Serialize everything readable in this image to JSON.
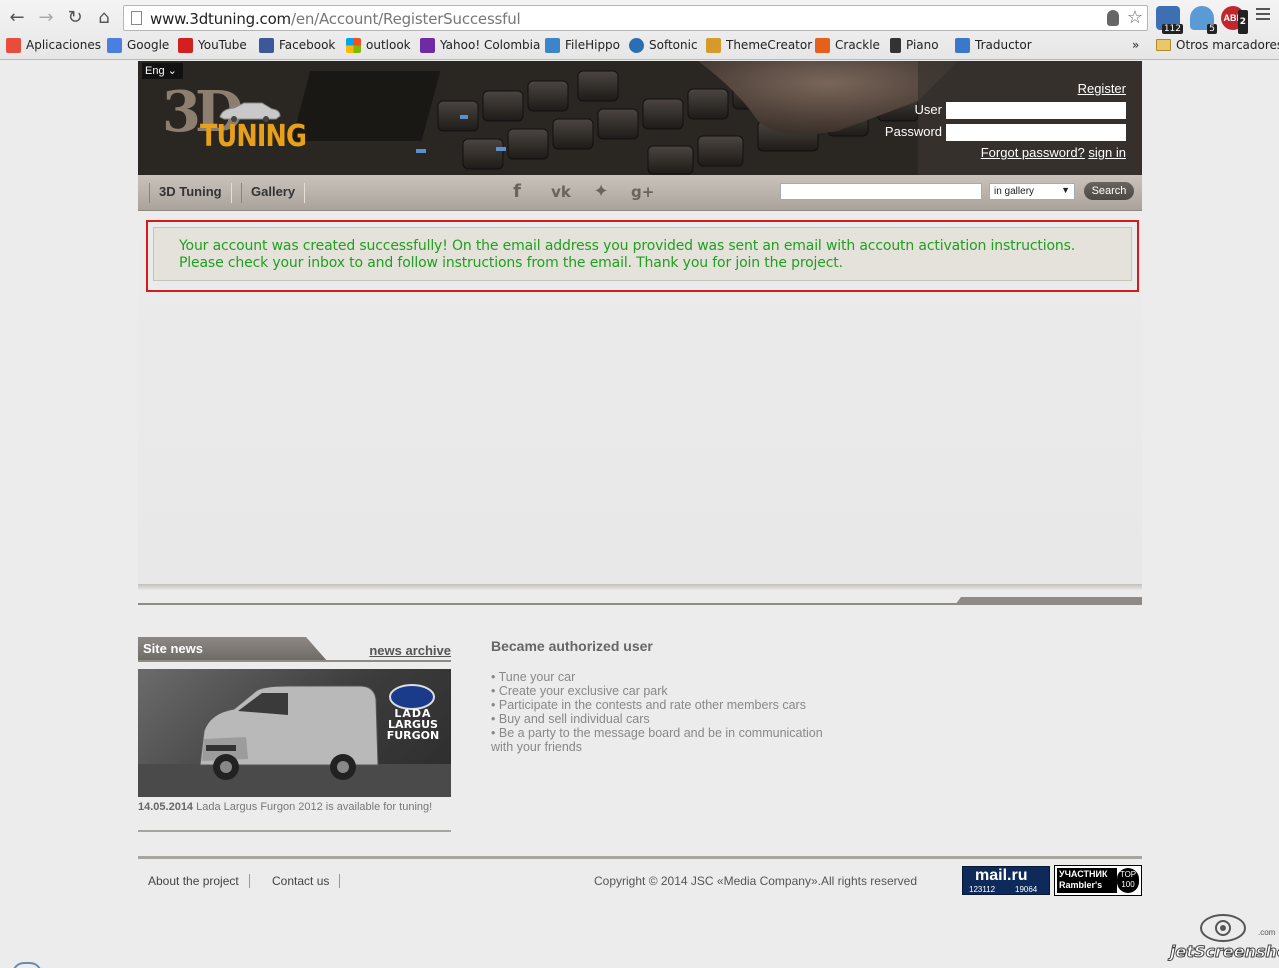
{
  "browser": {
    "url_host": "www.3dtuning.com",
    "url_path": "/en/Account/RegisterSuccessful",
    "extensions": [
      {
        "name": "weather-extension",
        "badge": "112",
        "color": "#3c6fb4"
      },
      {
        "name": "ghostery-extension",
        "badge": "5",
        "color": "#5a9bd6"
      },
      {
        "name": "adblock-plus-extension",
        "badge": "2",
        "color": "#c1272d",
        "label": "ABP"
      }
    ],
    "bookmarks": [
      {
        "label": "Aplicaciones",
        "icon": "apps-grid-icon",
        "color": "#e84c3d"
      },
      {
        "label": "Google",
        "icon": "google-icon",
        "color": "#4a7fe0"
      },
      {
        "label": "YouTube",
        "icon": "youtube-icon",
        "color": "#d21f1f"
      },
      {
        "label": "Facebook",
        "icon": "facebook-icon",
        "color": "#3b5998"
      },
      {
        "label": "outlook",
        "icon": "outlook-icon",
        "color": "#f0a30a"
      },
      {
        "label": "Yahoo! Colombia",
        "icon": "yahoo-icon",
        "color": "#6f2ba3"
      },
      {
        "label": "FileHippo",
        "icon": "filehippo-icon",
        "color": "#3a86c8"
      },
      {
        "label": "Softonic",
        "icon": "softonic-icon",
        "color": "#2a6fb3"
      },
      {
        "label": "ThemeCreator",
        "icon": "themecreator-icon",
        "color": "#d49a2a"
      },
      {
        "label": "Crackle",
        "icon": "crackle-icon",
        "color": "#e4601c"
      },
      {
        "label": "Piano",
        "icon": "piano-icon",
        "color": "#333333"
      },
      {
        "label": "Traductor",
        "icon": "translate-icon",
        "color": "#3b78c9"
      }
    ],
    "bookmarks_overflow": "»",
    "other_bookmarks": "Otros marcadores"
  },
  "site": {
    "lang": "Eng",
    "logo_3d": "3D",
    "logo_text": "TUNING",
    "register": "Register",
    "user_label": "User",
    "password_label": "Password",
    "forgot": "Forgot password?",
    "signin": "sign in",
    "nav": [
      "3D Tuning",
      "Gallery"
    ],
    "search_scope": "in gallery",
    "search_button": "Search",
    "message_line1": "Your account was created successfully! On the email address you provided was sent an email with accoutn activation instructions.",
    "message_line2": "Please check your inbox to and follow instructions from the email. Thank you for join the project.",
    "message_color": "#1fa01f",
    "highlight_color": "#d61b1b"
  },
  "news": {
    "header": "Site news",
    "archive": "news archive",
    "brand_line1": "LADA",
    "brand_line2": "LARGUS",
    "brand_line3": "FURGON",
    "date": "14.05.2014",
    "text": "Lada Largus Furgon 2012 is available for tuning!"
  },
  "authorized": {
    "title": "Became authorized user",
    "items": [
      "Tune your car",
      "Create your exclusive car park",
      "Participate in the contests and rate other members cars",
      "Buy and sell individual cars",
      "Be a party to the message board and be in communication with your friends"
    ]
  },
  "footer": {
    "links": [
      "About the project",
      "Contact us"
    ],
    "copyright": "Copyright © 2014 JSC «Media Company».All rights reserved",
    "mailru_logo": "mail.ru",
    "mailru_c1": "123112",
    "mailru_c2": "19064",
    "rambler_l1": "УЧАСТНИК",
    "rambler_l2": "Rambler's",
    "rambler_top": "TOP",
    "rambler_100": "100"
  },
  "watermark": "jetScreenshot",
  "watermark_com": ".com"
}
